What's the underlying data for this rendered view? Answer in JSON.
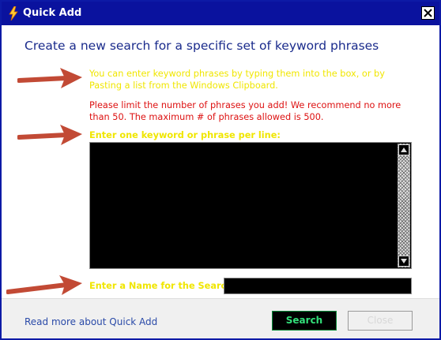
{
  "window": {
    "title": "Quick Add",
    "heading": "Create a new search for a specific set of keyword phrases"
  },
  "instructions": {
    "info": "You can enter keyword phrases by typing them into the box, or by Pasting a list from the Windows Clipboard.",
    "warning": "Please limit the number of phrases you add! We recommend no more than 50. The maximum # of phrases allowed is 500."
  },
  "keywords": {
    "label": "Enter one keyword or phrase per line:",
    "value": ""
  },
  "search_name": {
    "label": "Enter a Name for the Search:",
    "value": ""
  },
  "footer": {
    "read_more_link": "Read more about Quick Add",
    "search_button": "Search",
    "close_button": "Close"
  },
  "colors": {
    "titlebar": "#0a129e",
    "heading": "#1a2b8c",
    "info_text": "#f0e600",
    "warning_text": "#d11111",
    "annotation_arrow": "#c24a35",
    "search_text": "#33e07a"
  },
  "icons": {
    "app": "lightning-bolt-icon",
    "close": "close-icon",
    "scroll_up": "scroll-up-arrow-icon",
    "scroll_down": "scroll-down-arrow-icon",
    "annotation": "red-arrow-icon"
  }
}
